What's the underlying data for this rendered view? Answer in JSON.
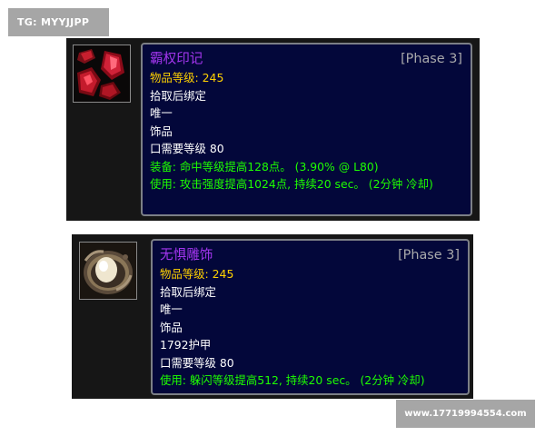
{
  "watermarks": {
    "top_left": "TG: MYYJJPP",
    "bottom_right": "www.17719994554.com"
  },
  "items": [
    {
      "icon": "red-gems-icon",
      "name": "霸权印记",
      "phase": "[Phase 3]",
      "item_level": "物品等级: 245",
      "binding": "拾取后绑定",
      "uniqueness": "唯一",
      "slot": "饰品",
      "armor": "",
      "required_level": "口需要等级 80",
      "equip": "装备: 命中等级提高128点。 (3.90% @ L80)",
      "use": "使用: 攻击强度提高1024点, 持续20 sec。 (2分钟 冷却)",
      "colors": {
        "name": "#a335ee",
        "item_level": "#ffd100",
        "effect": "#1eff00",
        "phase": "#a9a9ab"
      }
    },
    {
      "icon": "fearless-trinket-icon",
      "name": "无惧雕饰",
      "phase": "[Phase 3]",
      "item_level": "物品等级: 245",
      "binding": "拾取后绑定",
      "uniqueness": "唯一",
      "slot": "饰品",
      "armor": "1792护甲",
      "required_level": "口需要等级 80",
      "equip": "",
      "use": "使用: 躲闪等级提高512, 持续20 sec。 (2分钟 冷却)",
      "colors": {
        "name": "#a335ee",
        "item_level": "#ffd100",
        "effect": "#1eff00",
        "phase": "#a9a9ab"
      }
    }
  ]
}
